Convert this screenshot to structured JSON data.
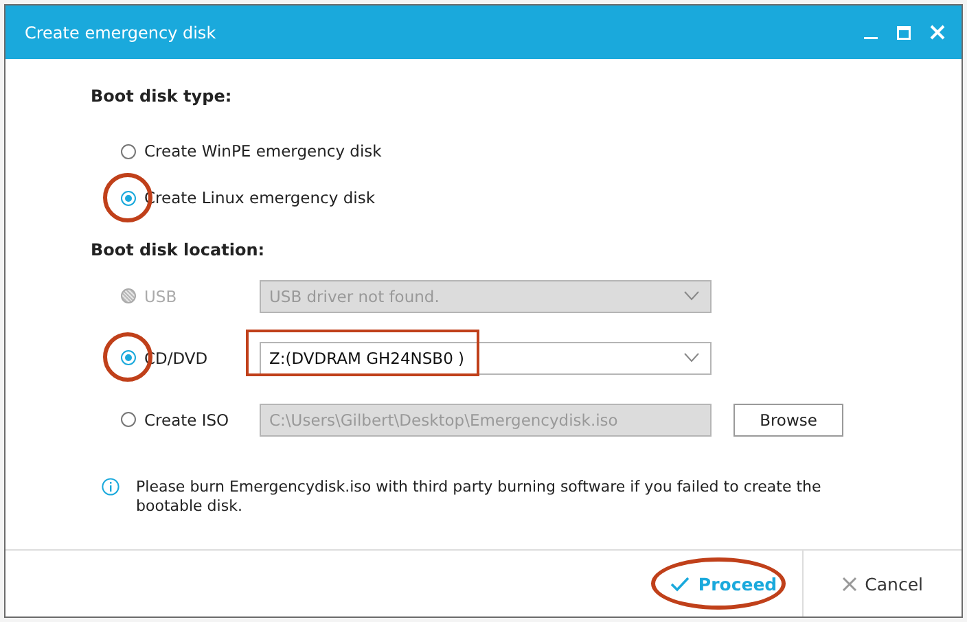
{
  "window": {
    "title": "Create emergency disk"
  },
  "boot_disk_type": {
    "heading": "Boot disk type:",
    "options": [
      {
        "label": "Create WinPE emergency disk",
        "selected": false,
        "highlighted": false
      },
      {
        "label": "Create Linux emergency disk",
        "selected": true,
        "highlighted": true
      }
    ]
  },
  "boot_disk_location": {
    "heading": "Boot disk location:",
    "options": [
      {
        "kind": "dropdown",
        "label": "USB",
        "selected": false,
        "disabled": true,
        "highlighted": false,
        "value": "USB driver not found.",
        "value_highlighted": false
      },
      {
        "kind": "dropdown",
        "label": "CD/DVD",
        "selected": true,
        "disabled": false,
        "highlighted": true,
        "value": "Z:(DVDRAM GH24NSB0 )",
        "value_highlighted": true
      },
      {
        "kind": "path",
        "label": "Create ISO",
        "selected": false,
        "disabled": false,
        "highlighted": false,
        "value": "C:\\Users\\Gilbert\\Desktop\\Emergencydisk.iso",
        "value_highlighted": false,
        "button": "Browse"
      }
    ]
  },
  "note": "Please burn Emergencydisk.iso with third party burning software if you failed to create the bootable disk.",
  "buttons": [
    {
      "kind": "proceed",
      "label": "Proceed",
      "highlighted": true
    },
    {
      "kind": "cancel",
      "label": "Cancel",
      "highlighted": false
    }
  ]
}
